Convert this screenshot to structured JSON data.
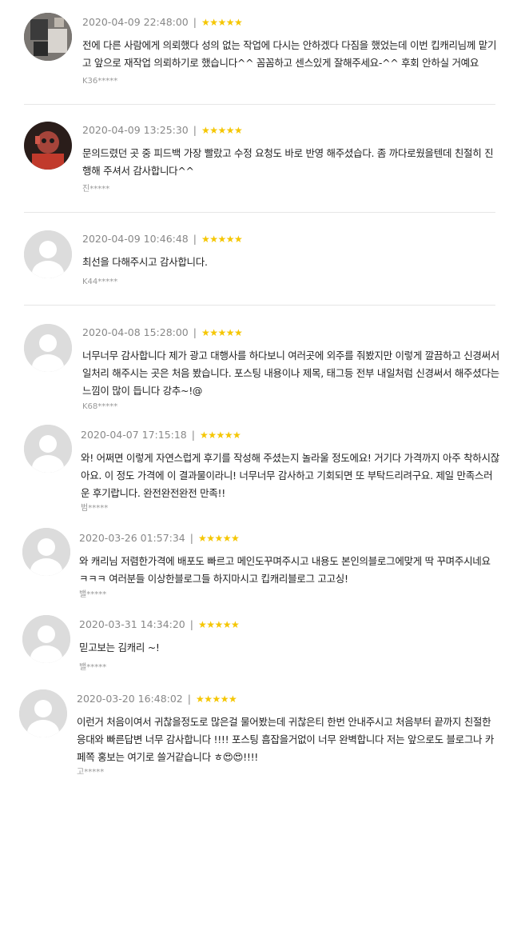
{
  "reviews": [
    {
      "date": "2020-04-09 22:48:00",
      "separator": "|",
      "stars": "★★★★★",
      "rating": 5,
      "text": "전에 다른 사람에게 의뢰했다 성의 없는 작업에 다시는 안하겠다 다짐을 했었는데 이번 킵캐리님께 맡기고 앞으로 재작업 의뢰하기로 했습니다^^ 꼼꼼하고 센스있게 잘해주세요-^^ 후회 안하실 거예요",
      "author": "K36*****",
      "avatar": "photo-1"
    },
    {
      "date": "2020-04-09 13:25:30",
      "separator": "|",
      "stars": "★★★★★",
      "rating": 5,
      "text": "문의드렸던 곳 중 피드백 가장 빨랐고 수정 요청도 바로 반영 해주셨습다. 좀 까다로웠을텐데 친절히 진행해 주셔서 감사합니다^^",
      "author": "진*****",
      "avatar": "photo-2"
    },
    {
      "date": "2020-04-09 10:46:48",
      "separator": "|",
      "stars": "★★★★★",
      "rating": 5,
      "text": "최선을 다해주시고 감사합니다.",
      "author": "K44*****",
      "avatar": "default"
    },
    {
      "date": "2020-04-08 15:28:00",
      "separator": "|",
      "stars": "★★★★★",
      "rating": 5,
      "text": "너무너무 감사합니다 제가 광고 대행사를 하다보니 여러곳에 외주를 줘봤지만 이렇게 깔끔하고 신경써서 일처리 해주시는 곳은 처음 봤습니다. 포스팅 내용이나 제목, 태그등 전부 내일처럼 신경써서 해주셨다는 느낌이 많이 듭니다 강추~!@",
      "author": "K68*****",
      "avatar": "default"
    },
    {
      "date": "2020-04-07 17:15:18",
      "separator": "|",
      "stars": "★★★★★",
      "rating": 5,
      "text": "와! 어쩌면 이렇게 자연스럽게 후기를 작성해 주셨는지 놀라울 정도에요! 거기다 가격까지 아주 착하시잖아요. 이 정도 가격에 이 결과물이라니! 너무너무 감사하고 기회되면 또 부탁드리려구요. 제일 만족스러운 후기랍니다. 완전완전완전 만족!!",
      "author": "범*****",
      "avatar": "default"
    },
    {
      "date": "2020-03-26 01:57:34",
      "separator": "|",
      "stars": "★★★★★",
      "rating": 5,
      "text": "와 캐리님 저렴한가격에 배포도 빠르고 메인도꾸며주시고 내용도 본인의블로그에맞게 딱 꾸며주시네요 ㅋㅋㅋ 여러분들 이상한블로그들 하지마시고 킵캐리블로그 고고싱!",
      "author": "밸*****",
      "avatar": "default"
    },
    {
      "date": "2020-03-31 14:34:20",
      "separator": "|",
      "stars": "★★★★★",
      "rating": 5,
      "text": "믿고보는 김캐리 ~!",
      "author": "밸*****",
      "avatar": "default"
    },
    {
      "date": "2020-03-20 16:48:02",
      "separator": "|",
      "stars": "★★★★★",
      "rating": 5,
      "text": "이런거 처음이여서 귀찮을정도로 많은걸 물어봤는데 귀찮은티 한번 안내주시고 처음부터 끝까지 친절한응대와 빠른답변 너무 감사합니다 !!!! 포스팅 흠잡을거없이 너무 완벽합니다 저는 앞으로도 블로그나 카페쪽 홍보는 여기로 쓸거같습니다 ㅎ😍😍!!!!",
      "author": "고*****",
      "avatar": "default"
    }
  ],
  "colors": {
    "star": "#f5c600",
    "divider": "#e6e6e6",
    "meta": "#888888",
    "text": "#222222",
    "author": "#999999"
  }
}
